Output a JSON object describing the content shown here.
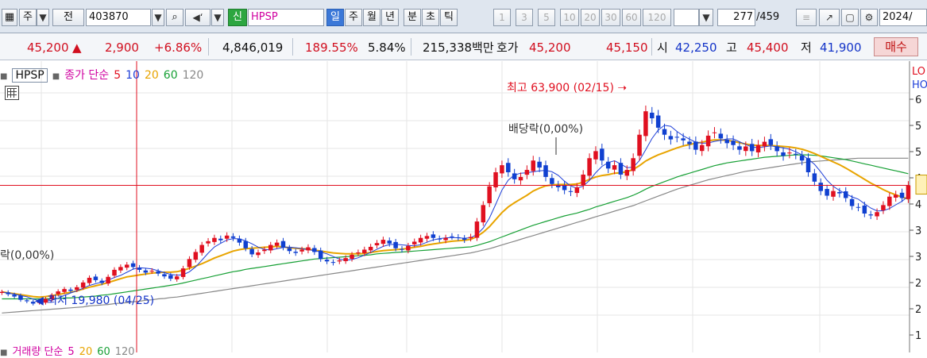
{
  "toolbar": {
    "menu_icon": "menu-icon",
    "market_label": "주",
    "prev_label": "전",
    "code": "403870",
    "name_badge": "신",
    "stock_name": "HPSP",
    "periods": [
      "일",
      "주",
      "월",
      "년",
      "분",
      "초",
      "틱"
    ],
    "active_period": "일",
    "intervals": [
      "1",
      "3",
      "5",
      "10",
      "20",
      "30",
      "60",
      "120"
    ],
    "page_current": "277",
    "page_total": "/459",
    "date": "2024/"
  },
  "quote": {
    "price": "45,200",
    "arrow": "▲",
    "change": "2,900",
    "change_pct": "+6.86%",
    "volume": "4,846,019",
    "volume_ratio": "189.55%",
    "turnover": "5.84%",
    "amount": "215,338백만",
    "ask_label": "호가",
    "ask1": "45,200",
    "ask2": "45,150",
    "open_label": "시",
    "open": "42,250",
    "high_label": "고",
    "high": "45,400",
    "low_label": "저",
    "low": "41,900",
    "buy_button": "매수"
  },
  "legend": {
    "symbol": "HPSP",
    "price_label": "종가 단순",
    "ma": [
      {
        "label": "5",
        "color": "#1f3fd8"
      },
      {
        "label": "10",
        "color": "#1f3fd8"
      },
      {
        "label": "20",
        "color": "#e8a400"
      },
      {
        "label": "60",
        "color": "#17a035"
      },
      {
        "label": "120",
        "color": "#888888"
      }
    ],
    "price_color": "#d000a0"
  },
  "annotations": {
    "high_label": "최고 63,900 (02/15)",
    "low_label": "최저 19,980 (04/25)",
    "dividend_label": "배당락(0,00%)",
    "dividend_left_label": "락(0,00%)"
  },
  "right_axis": {
    "top_labels": [
      "LO",
      "HO"
    ],
    "ticks": [
      "6",
      "5",
      "5",
      "4",
      "4",
      "3",
      "3",
      "2",
      "2",
      "1"
    ]
  },
  "sub_legend": {
    "label": "거래량 단순",
    "ma": [
      {
        "label": "5",
        "color": "#d000a0"
      },
      {
        "label": "20",
        "color": "#e8a400"
      },
      {
        "label": "60",
        "color": "#17a035"
      },
      {
        "label": "120",
        "color": "#888888"
      }
    ]
  },
  "chart_data": {
    "type": "candlestick",
    "ylim": [
      15000,
      70000
    ],
    "current_price": 45200,
    "high": {
      "value": 63900,
      "date": "02/15"
    },
    "low": {
      "value": 19980,
      "date": "04/25"
    },
    "closes": [
      22500,
      22000,
      21500,
      20800,
      20500,
      20000,
      20300,
      21000,
      21800,
      22600,
      23100,
      22700,
      23500,
      24500,
      25500,
      25000,
      24400,
      25700,
      27200,
      27800,
      28300,
      27800,
      27200,
      26600,
      27000,
      26400,
      25800,
      25300,
      25800,
      27500,
      29500,
      31000,
      32500,
      33300,
      34000,
      33500,
      34500,
      34000,
      33000,
      31800,
      30500,
      30900,
      31500,
      32500,
      33000,
      32000,
      31200,
      30800,
      31500,
      32000,
      31000,
      29500,
      29000,
      28700,
      29200,
      29700,
      30400,
      30900,
      31500,
      32100,
      32900,
      33600,
      32800,
      31800,
      31500,
      32300,
      33200,
      34000,
      34400,
      34000,
      33700,
      34000,
      34300,
      34100,
      33600,
      34200,
      37500,
      41000,
      45000,
      48000,
      49500,
      48000,
      46500,
      47000,
      48500,
      50500,
      49000,
      47000,
      45500,
      44800,
      44200,
      43800,
      44800,
      47500,
      51000,
      52500,
      50500,
      48800,
      49500,
      47500,
      48500,
      51000,
      56000,
      61000,
      59500,
      57500,
      56000,
      55000,
      55500,
      54800,
      54000,
      52800,
      53800,
      55800,
      56500,
      55200,
      54200,
      53800,
      52800,
      53500,
      52500,
      53800,
      54500,
      53800,
      52500,
      51500,
      52200,
      51800,
      50500,
      48000,
      46000,
      44000,
      43000,
      44000,
      43500,
      42500,
      40800,
      40500,
      39200,
      38800,
      39500,
      41000,
      42800,
      43200,
      42500,
      45200
    ],
    "ma20": [
      22500,
      22300,
      22100,
      21900,
      21700,
      21500,
      21400,
      21500,
      21700,
      21900,
      22200,
      22400,
      22700,
      23100,
      23500,
      23800,
      24100,
      24500,
      24900,
      25300,
      25700,
      25900,
      26100,
      26300,
      26500,
      26600,
      26700,
      26700,
      26800,
      27100,
      27500,
      28000,
      28500,
      29100,
      29700,
      30200,
      30700,
      31200,
      31500,
      31700,
      31800,
      31900,
      32000,
      32100,
      32200,
      32100,
      31900,
      31800,
      31700,
      31600,
      31400,
      31200,
      31000,
      30800,
      30700,
      30600,
      30600,
      30600,
      30700,
      30900,
      31100,
      31300,
      31400,
      31500,
      31600,
      31800,
      32000,
      32200,
      32500,
      32700,
      32900,
      33100,
      33300,
      33400,
      33500,
      33700,
      34300,
      35200,
      36400,
      37900,
      39400,
      40600,
      41500,
      42300,
      43100,
      44000,
      44600,
      45100,
      45300,
      45400,
      45400,
      45400,
      45500,
      45900,
      46500,
      47000,
      47300,
      47500,
      47800,
      47900,
      48100,
      48600,
      49400,
      50400,
      51100,
      51700,
      52200,
      52700,
      53200,
      53600,
      53900,
      54200,
      54400,
      54700,
      54900,
      54900,
      54800,
      54600,
      54300,
      54000,
      53800,
      53700,
      53700,
      53700,
      53600,
      53500,
      53400,
      53200,
      52900,
      52500,
      52000,
      51400,
      50800,
      50200,
      49600,
      48900,
      48100,
      47300,
      46500,
      45700,
      45000,
      44300,
      43700,
      43200,
      42700,
      42300
    ],
    "ma60": [
      21000,
      21000,
      21000,
      21000,
      21000,
      21000,
      21000,
      21000,
      21100,
      21100,
      21200,
      21200,
      21300,
      21400,
      21500,
      21600,
      21800,
      21900,
      22100,
      22300,
      22500,
      22700,
      22900,
      23100,
      23300,
      23500,
      23700,
      23900,
      24100,
      24400,
      24700,
      25000,
      25300,
      25600,
      25900,
      26200,
      26500,
      26800,
      27000,
      27300,
      27500,
      27700,
      27900,
      28100,
      28300,
      28500,
      28700,
      28900,
      29100,
      29300,
      29500,
      29600,
      29700,
      29800,
      29900,
      30000,
      30100,
      30200,
      30300,
      30400,
      30600,
      30700,
      30800,
      30900,
      31000,
      31100,
      31200,
      31300,
      31400,
      31500,
      31600,
      31700,
      31800,
      31900,
      32000,
      32100,
      32400,
      32800,
      33200,
      33700,
      34200,
      34700,
      35200,
      35700,
      36200,
      36700,
      37100,
      37500,
      37900,
      38300,
      38700,
      39000,
      39300,
      39700,
      40100,
      40600,
      41000,
      41400,
      41800,
      42200,
      42600,
      43100,
      43700,
      44400,
      45000,
      45500,
      46000,
      46500,
      47000,
      47400,
      47800,
      48200,
      48600,
      49000,
      49400,
      49700,
      50000,
      50200,
      50400,
      50600,
      50800,
      51000,
      51200,
      51300,
      51400,
      51500,
      51600,
      51700,
      51700,
      51700,
      51600,
      51500,
      51300,
      51100,
      50900,
      50700,
      50400,
      50100,
      49800,
      49500,
      49200,
      48900,
      48600,
      48300,
      48000,
      47700
    ],
    "ma120": [
      18000,
      18100,
      18200,
      18300,
      18400,
      18500,
      18600,
      18700,
      18800,
      18900,
      19000,
      19100,
      19200,
      19300,
      19500,
      19600,
      19700,
      19800,
      20000,
      20100,
      20200,
      20400,
      20500,
      20700,
      20800,
      21000,
      21100,
      21300,
      21400,
      21600,
      21800,
      22000,
      22200,
      22400,
      22600,
      22800,
      23000,
      23200,
      23400,
      23600,
      23800,
      24000,
      24200,
      24400,
      24600,
      24800,
      25000,
      25200,
      25400,
      25600,
      25800,
      26000,
      26200,
      26400,
      26600,
      26800,
      27000,
      27200,
      27400,
      27600,
      27800,
      28000,
      28200,
      28400,
      28600,
      28800,
      29000,
      29200,
      29400,
      29600,
      29800,
      30000,
      30200,
      30400,
      30600,
      30800,
      31100,
      31400,
      31700,
      32100,
      32500,
      32900,
      33300,
      33700,
      34100,
      34500,
      34900,
      35300,
      35700,
      36100,
      36500,
      36900,
      37300,
      37700,
      38100,
      38500,
      38900,
      39300,
      39700,
      40100,
      40500,
      40900,
      41400,
      41900,
      42400,
      42900,
      43400,
      43900,
      44400,
      44800,
      45200,
      45600,
      46000,
      46400,
      46700,
      47000,
      47300,
      47600,
      47900,
      48200,
      48400,
      48600,
      48800,
      49000,
      49200,
      49400,
      49600,
      49800,
      50000,
      50200,
      50300,
      50400,
      50500,
      50600,
      50700,
      50800,
      50900,
      51000,
      51000,
      51000,
      51000,
      51000,
      51000,
      51000,
      51000,
      51000
    ]
  },
  "colors": {
    "up": "#e01020",
    "down": "#1040d0",
    "ma5": "#1f3fd8",
    "ma20": "#e8a400",
    "ma60": "#17a035",
    "ma120": "#888888",
    "crosshair": "#e01020"
  }
}
